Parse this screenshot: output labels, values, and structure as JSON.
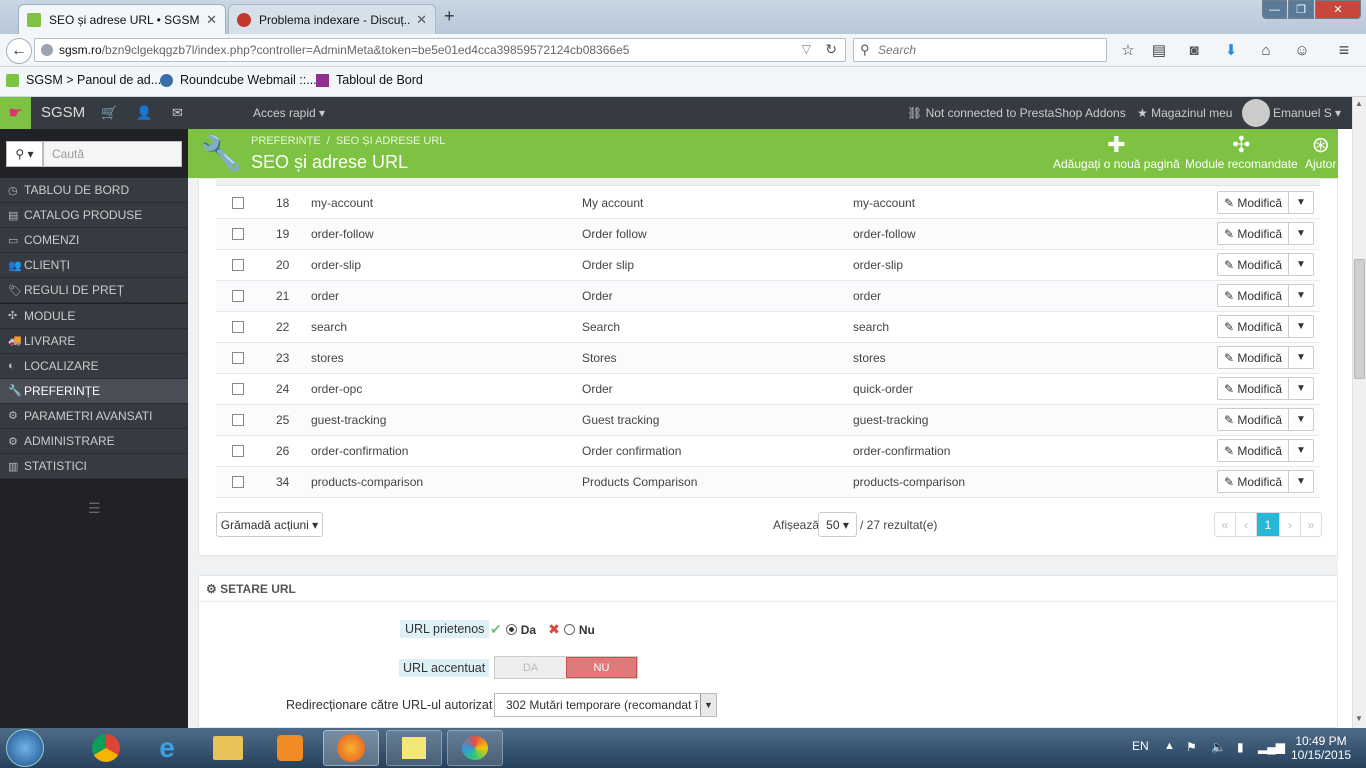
{
  "browser": {
    "tabs": [
      {
        "title": "SEO și adrese URL • SGSM",
        "active": true
      },
      {
        "title": "Problema indexare - Discuț...",
        "active": false
      }
    ],
    "new_tab": "+",
    "window_controls": {
      "minimize": "—",
      "maximize": "❐",
      "close": "✕"
    },
    "url": "sgsm.ro/bzn9clgekqgzb7l/index.php?controller=AdminMeta&token=be5e01ed4cca39859572124cb08366e5",
    "url_domain": "sgsm.ro",
    "url_path": "/bzn9clgekqgzb7l/index.php?controller=AdminMeta&token=be5e01ed4cca39859572124cb08366e5",
    "search_placeholder": "Search",
    "bookmarks": [
      "SGSM > Panoul de ad...",
      "Roundcube Webmail ::...",
      "Tabloul de Bord"
    ]
  },
  "header": {
    "brand": "SGSM",
    "quick_access": "Acces rapid",
    "addons_status": "Not connected to PrestaShop Addons",
    "my_store": "Magazinul meu",
    "user": "Emanuel S"
  },
  "sidebar": {
    "search_placeholder": "Caută",
    "items": [
      {
        "label": "TABLOU DE BORD",
        "icon": "dashboard-icon"
      },
      {
        "label": "CATALOG PRODUSE",
        "icon": "book-icon"
      },
      {
        "label": "COMENZI",
        "icon": "credit-card-icon"
      },
      {
        "label": "CLIENȚI",
        "icon": "users-icon"
      },
      {
        "label": "REGULI DE PREȚ",
        "icon": "tags-icon"
      },
      {
        "label": "MODULE",
        "icon": "puzzle-icon"
      },
      {
        "label": "LIVRARE",
        "icon": "truck-icon"
      },
      {
        "label": "LOCALIZARE",
        "icon": "globe-icon"
      },
      {
        "label": "PREFERINȚE",
        "icon": "wrench-icon",
        "active": true
      },
      {
        "label": "PARAMETRI AVANSATI",
        "icon": "cogs-icon"
      },
      {
        "label": "ADMINISTRARE",
        "icon": "cog-icon"
      },
      {
        "label": "STATISTICI",
        "icon": "bar-chart-icon"
      }
    ]
  },
  "toolbar": {
    "breadcrumb": [
      "PREFERINȚE",
      "SEO ȘI ADRESE URL"
    ],
    "title": "SEO și adrese URL",
    "buttons": [
      "Adăugați o nouă pagină",
      "Module recomandate",
      "Ajutor"
    ]
  },
  "table": {
    "edit_label": "Modifică",
    "rows": [
      {
        "id": "18",
        "page": "my-account",
        "title": "My account",
        "rewrite": "my-account"
      },
      {
        "id": "19",
        "page": "order-follow",
        "title": "Order follow",
        "rewrite": "order-follow"
      },
      {
        "id": "20",
        "page": "order-slip",
        "title": "Order slip",
        "rewrite": "order-slip"
      },
      {
        "id": "21",
        "page": "order",
        "title": "Order",
        "rewrite": "order"
      },
      {
        "id": "22",
        "page": "search",
        "title": "Search",
        "rewrite": "search"
      },
      {
        "id": "23",
        "page": "stores",
        "title": "Stores",
        "rewrite": "stores"
      },
      {
        "id": "24",
        "page": "order-opc",
        "title": "Order",
        "rewrite": "quick-order"
      },
      {
        "id": "25",
        "page": "guest-tracking",
        "title": "Guest tracking",
        "rewrite": "guest-tracking"
      },
      {
        "id": "26",
        "page": "order-confirmation",
        "title": "Order confirmation",
        "rewrite": "order-confirmation"
      },
      {
        "id": "34",
        "page": "products-comparison",
        "title": "Products Comparison",
        "rewrite": "products-comparison"
      }
    ],
    "bulk_actions": "Grămadă acțiuni",
    "show_label": "Afișează",
    "per_page": "50",
    "result_count": "/ 27 rezultat(e)",
    "current_page": "1"
  },
  "url_settings": {
    "heading": "SETARE URL",
    "friendly_label": "URL prietenos",
    "friendly_yes": "Da",
    "friendly_no": "Nu",
    "accented_label": "URL accentuat",
    "toggle_yes": "DA",
    "toggle_no": "NU",
    "redirect_label": "Redirecționare către URL-ul autorizat",
    "redirect_value": "302 Mutări temporare (recomandat î"
  },
  "taskbar": {
    "lang": "EN",
    "time": "10:49 PM",
    "date": "10/15/2015"
  },
  "colors": {
    "green": "#7dc242",
    "dark": "#363a41",
    "active_page": "#25b9d7",
    "danger": "#e07a7a"
  }
}
